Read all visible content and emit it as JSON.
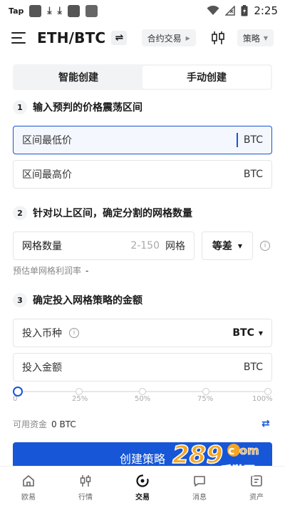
{
  "status_bar": {
    "app_label": "Tap",
    "time": "2:25"
  },
  "header": {
    "pair": "ETH/BTC",
    "swap_icon": "⇌",
    "contract_label": "合约交易",
    "strategy_label": "策略"
  },
  "mode_tabs": [
    {
      "label": "智能创建",
      "active": false
    },
    {
      "label": "手动创建",
      "active": true
    }
  ],
  "section1": {
    "num": "1",
    "title": "输入预判的价格震荡区间",
    "low_placeholder": "区间最低价",
    "low_unit": "BTC",
    "high_placeholder": "区间最高价",
    "high_unit": "BTC"
  },
  "section2": {
    "num": "2",
    "title": "针对以上区间，确定分割的网格数量",
    "grid_label": "网格数量",
    "grid_range": "2-150",
    "grid_unit": "网格",
    "grid_mode": "等差",
    "profit_label": "预估单网格利润率",
    "profit_value": "-"
  },
  "section3": {
    "num": "3",
    "title": "确定投入网格策略的金额",
    "coin_label": "投入币种",
    "coin_value": "BTC",
    "amount_label": "投入金额",
    "amount_unit": "BTC",
    "slider_value_percent": 0,
    "slider_ticks": [
      "0",
      "25%",
      "50%",
      "75%",
      "100%"
    ],
    "available_label": "可用资金",
    "available_value": "0 BTC"
  },
  "create_button": "创建策略",
  "bottom_nav": [
    {
      "label": "欧易",
      "icon": "home-icon",
      "active": false
    },
    {
      "label": "行情",
      "icon": "market-icon",
      "active": false
    },
    {
      "label": "交易",
      "icon": "trade-icon",
      "active": true
    },
    {
      "label": "消息",
      "icon": "message-icon",
      "active": false
    },
    {
      "label": "资产",
      "icon": "assets-icon",
      "active": false
    }
  ],
  "watermark": {
    "brand": "289",
    "suffix": "com",
    "tagline": "手游网"
  },
  "colors": {
    "accent": "#1756d6",
    "field_border": "#e3e5e8",
    "muted": "#888888"
  }
}
